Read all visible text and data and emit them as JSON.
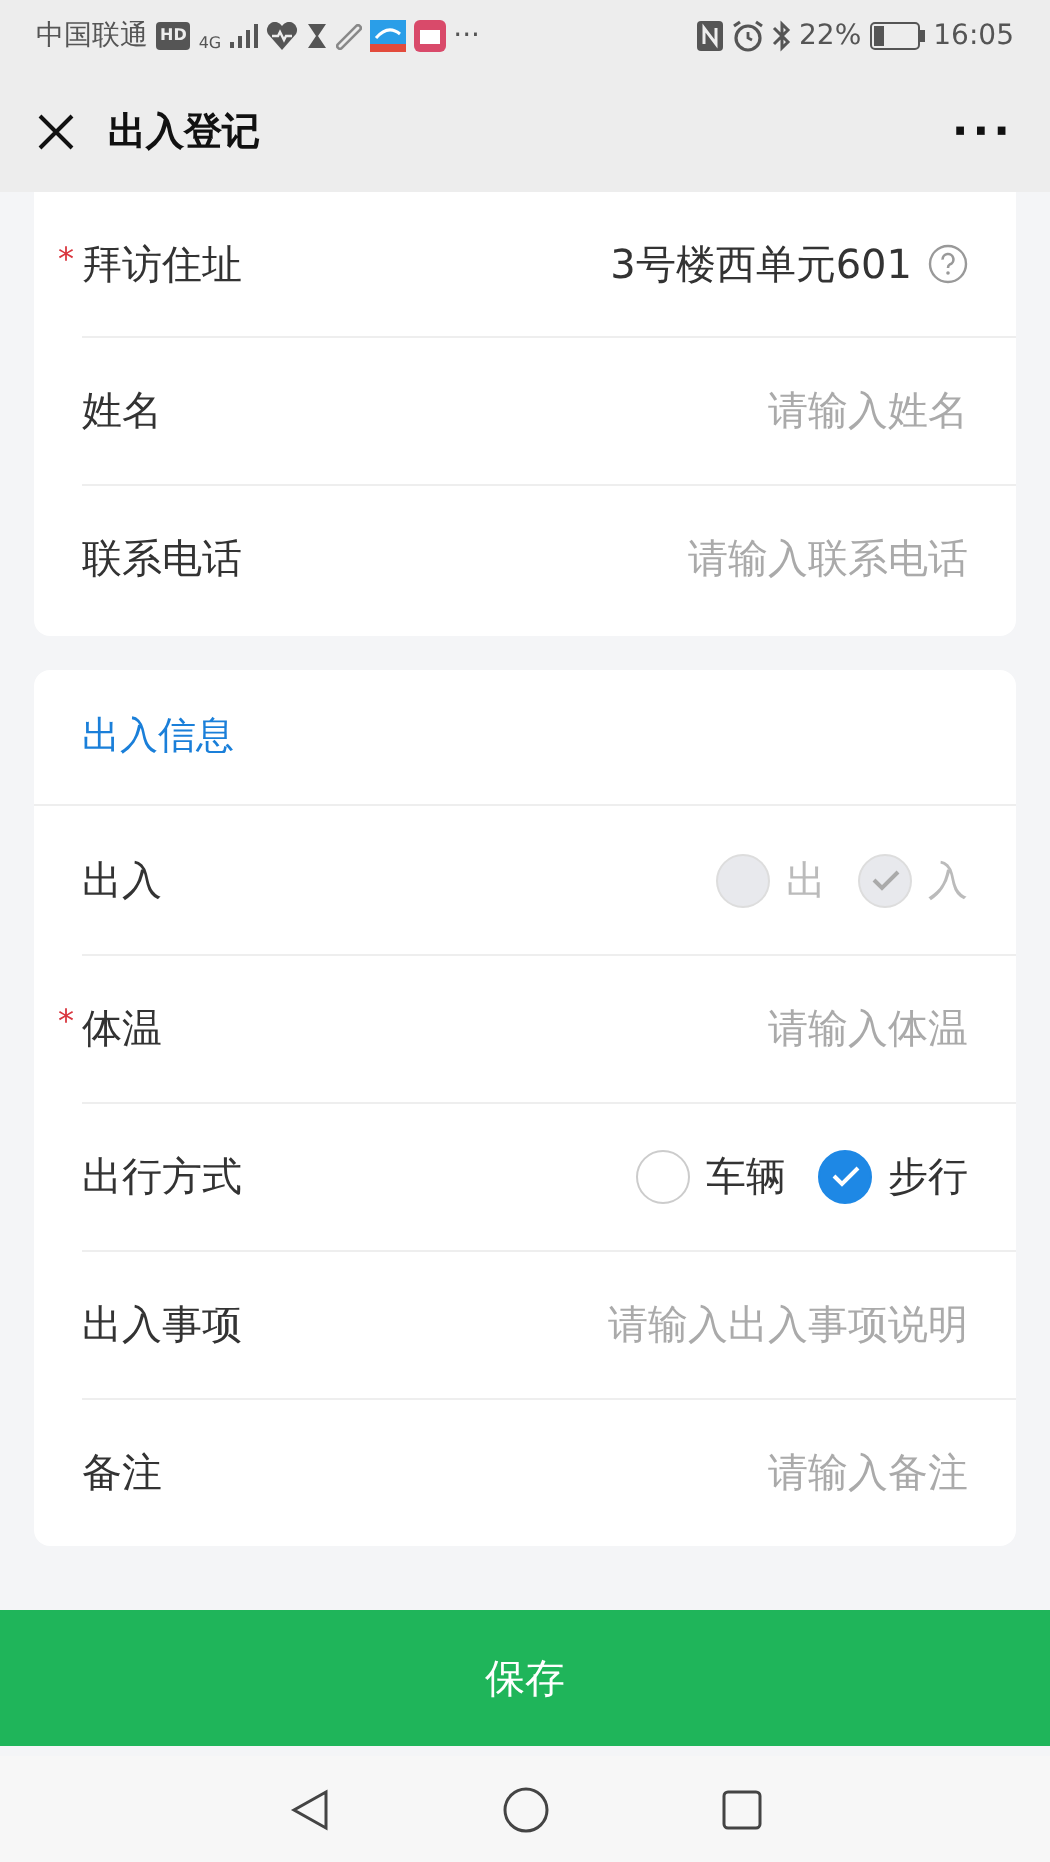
{
  "status_bar": {
    "carrier": "中国联通",
    "hd_badge": "HD",
    "network": "4G",
    "more": "···",
    "battery": "22%",
    "time": "16:05"
  },
  "nav_bar": {
    "title": "出入登记",
    "menu": "···"
  },
  "sections": [
    {
      "fields": [
        {
          "kind": "value",
          "required_mark": "*",
          "label": "拜访住址",
          "value": "3号楼西单元601"
        },
        {
          "kind": "input",
          "label": "姓名",
          "placeholder": "请输入姓名"
        },
        {
          "kind": "input",
          "label": "联系电话",
          "placeholder": "请输入联系电话"
        }
      ]
    },
    {
      "title": "出入信息",
      "fields": [
        {
          "kind": "radio",
          "label": "出入",
          "disabled": true,
          "options": [
            {
              "label": "出",
              "selected": false
            },
            {
              "label": "入",
              "selected": true
            }
          ]
        },
        {
          "kind": "input",
          "required_mark": "*",
          "label": "体温",
          "placeholder": "请输入体温"
        },
        {
          "kind": "radio",
          "label": "出行方式",
          "disabled": false,
          "options": [
            {
              "label": "车辆",
              "selected": false
            },
            {
              "label": "步行",
              "selected": true
            }
          ]
        },
        {
          "kind": "input",
          "label": "出入事项",
          "placeholder": "请输入出入事项说明"
        },
        {
          "kind": "input",
          "label": "备注",
          "placeholder": "请输入备注"
        }
      ]
    }
  ],
  "save_button": "保存"
}
